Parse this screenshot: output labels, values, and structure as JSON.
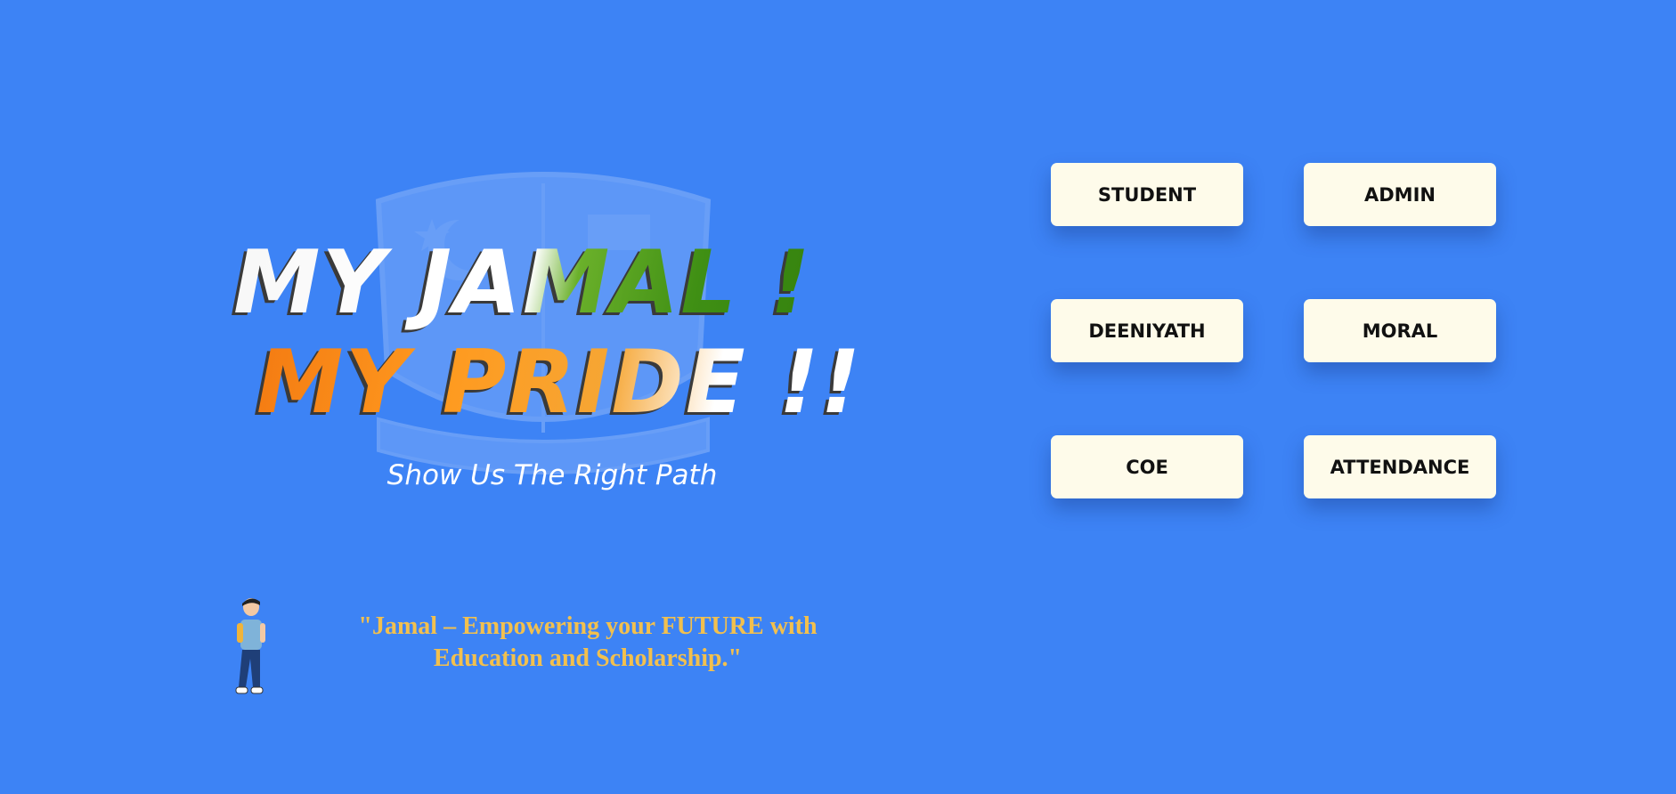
{
  "hero": {
    "title_line_1": "My Jamal !",
    "title_line_2": "My Pride !!",
    "tagline": "Show Us The Right Path"
  },
  "quote": {
    "text": "\"Jamal – Empowering your FUTURE with Education and Scholarship.\""
  },
  "roles": {
    "student": "STUDENT",
    "admin": "ADMIN",
    "deeniyath": "DEENIYATH",
    "moral": "MORAL",
    "coe": "COE",
    "attendance": "ATTENDANCE"
  },
  "colors": {
    "background": "#3d83f5",
    "button_bg": "#fefbea",
    "quote": "#f2c04e",
    "saffron": "#f47b12",
    "green": "#3f8f14"
  }
}
